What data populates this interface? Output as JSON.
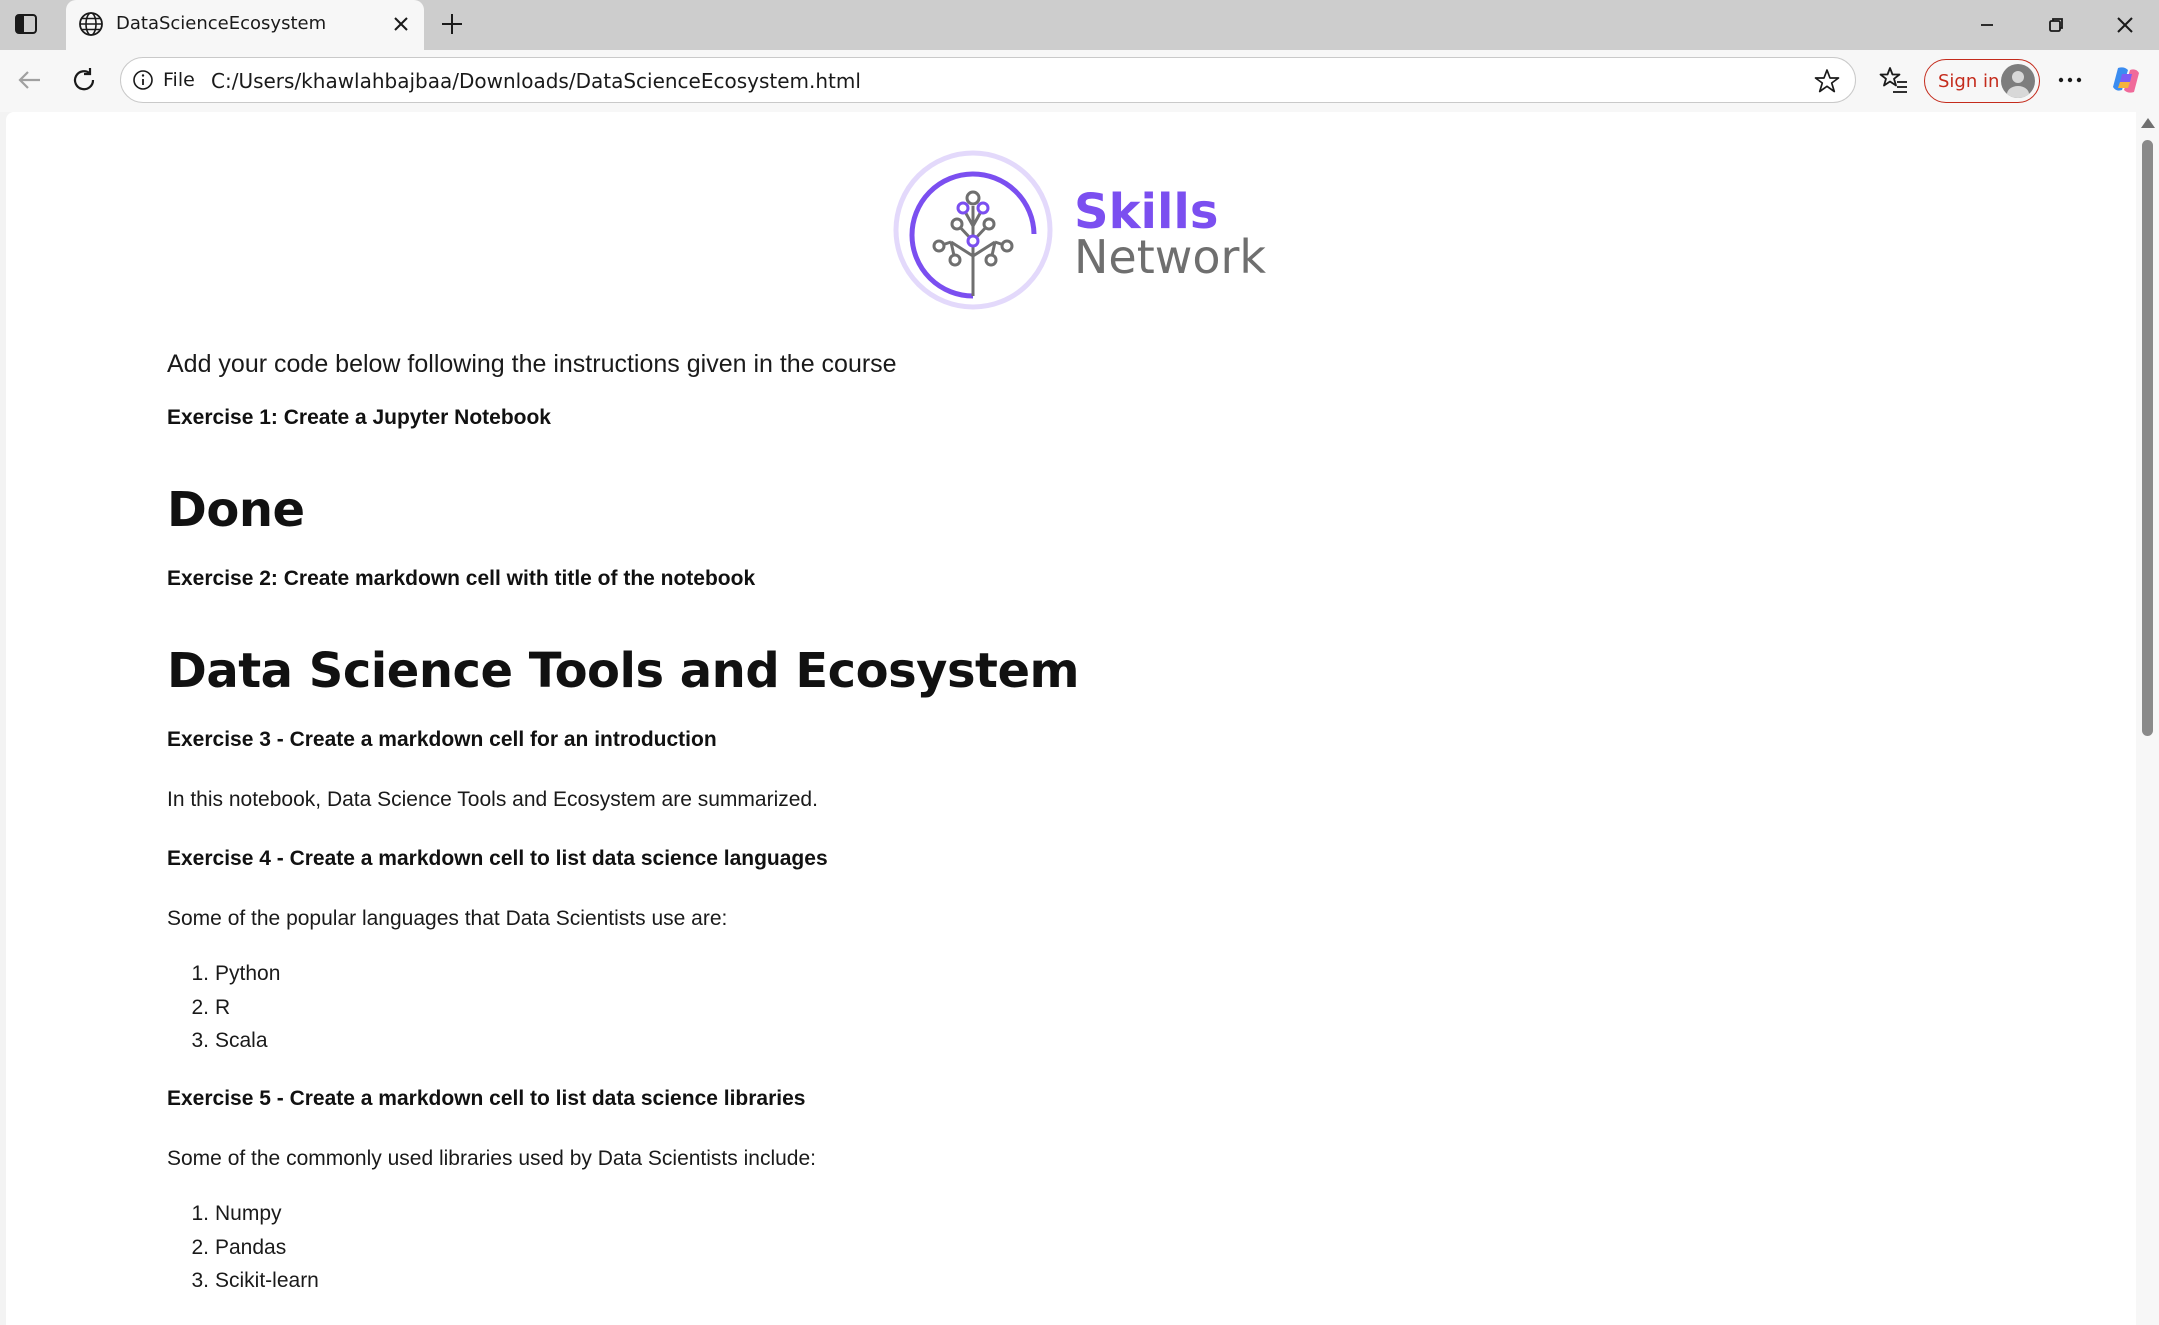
{
  "browser": {
    "tab_title": "DataScienceEcosystem",
    "address_scheme": "File",
    "address_url": "C:/Users/khawlahbajbaa/Downloads/DataScienceEcosystem.html",
    "signin_label": "Sign in",
    "accent_color": "#c42b1c"
  },
  "logo": {
    "line1": "Skills",
    "line2": "Network",
    "brand_color": "#7b4ff0"
  },
  "page": {
    "instructions": "Add your code below following the instructions given in the course",
    "ex1": "Exercise 1: Create a Jupyter Notebook",
    "done": "Done",
    "ex2": "Exercise 2: Create markdown cell with title of the notebook",
    "title": "Data Science Tools and Ecosystem",
    "ex3": "Exercise 3 - Create a markdown cell for an introduction",
    "intro": "In this notebook, Data Science Tools and Ecosystem are summarized.",
    "ex4": "Exercise 4 - Create a markdown cell to list data science languages",
    "languages_intro": "Some of the popular languages that Data Scientists use are:",
    "languages": [
      "Python",
      "R",
      "Scala"
    ],
    "ex5": "Exercise 5 - Create a markdown cell to list data science libraries",
    "libraries_intro": "Some of the commonly used libraries used by Data Scientists include:",
    "libraries": [
      "Numpy",
      "Pandas",
      "Scikit-learn"
    ]
  }
}
